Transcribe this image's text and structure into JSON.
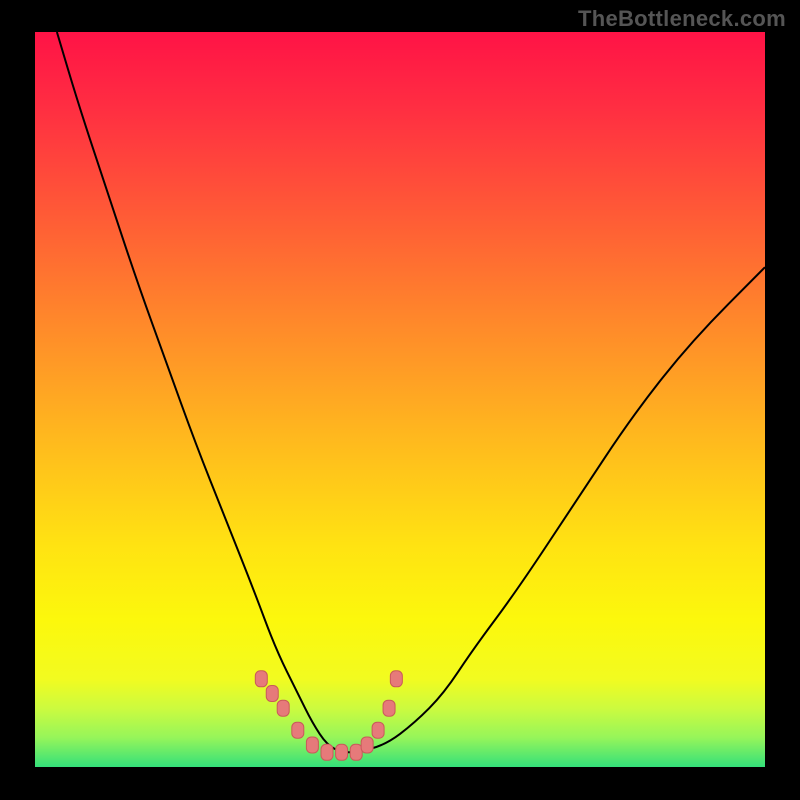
{
  "watermark": "TheBottleneck.com",
  "chart_data": {
    "type": "line",
    "title": "",
    "xlabel": "",
    "ylabel": "",
    "xlim": [
      0,
      100
    ],
    "ylim": [
      0,
      100
    ],
    "series": [
      {
        "name": "bottleneck-curve",
        "x": [
          3,
          6,
          10,
          14,
          18,
          22,
          26,
          30,
          33,
          36,
          38,
          40,
          42,
          44,
          48,
          52,
          56,
          60,
          66,
          74,
          82,
          90,
          100
        ],
        "y": [
          100,
          90,
          78,
          66,
          55,
          44,
          34,
          24,
          16,
          10,
          6,
          3,
          2,
          2,
          3,
          6,
          10,
          16,
          24,
          36,
          48,
          58,
          68
        ]
      },
      {
        "name": "bead-markers",
        "x": [
          31,
          32.5,
          34,
          36,
          38,
          40,
          42,
          44,
          45.5,
          47,
          48.5,
          49.5
        ],
        "y": [
          12,
          10,
          8,
          5,
          3,
          2,
          2,
          2,
          3,
          5,
          8,
          12
        ]
      }
    ],
    "colors": {
      "curve": "#000000",
      "beads_fill": "#e67a7a",
      "beads_stroke": "#c95a5a"
    }
  }
}
